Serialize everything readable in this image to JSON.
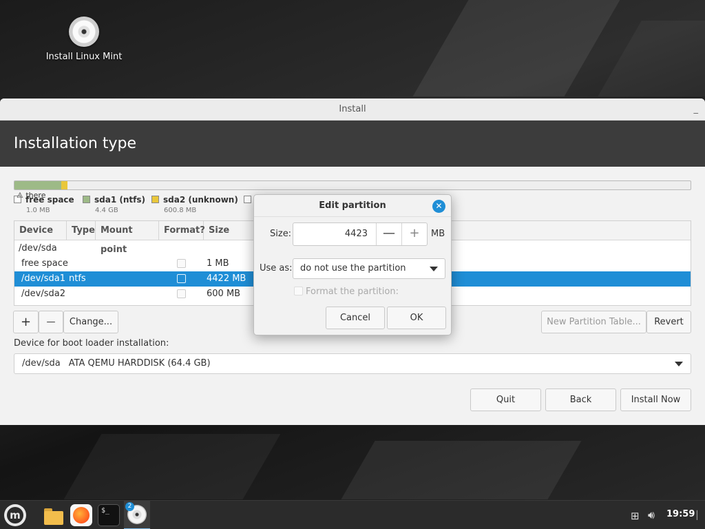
{
  "desktop": {
    "icon_label": "Install Linux Mint"
  },
  "window": {
    "title": "Install"
  },
  "header": {
    "title": "Installation type"
  },
  "legend": {
    "warning_text": "there",
    "items": [
      {
        "label": "free space",
        "size": "1.0 MB",
        "color": "#ffffff"
      },
      {
        "label": "sda1 (ntfs)",
        "size": "4.4 GB",
        "color": "#9dba87"
      },
      {
        "label": "sda2 (unknown)",
        "size": "600.8 MB",
        "color": "#e9c73b"
      },
      {
        "label": "",
        "size": "",
        "color": "#ffffff"
      }
    ]
  },
  "table": {
    "columns": [
      "Device",
      "Type",
      "Mount point",
      "Format?",
      "Size"
    ],
    "rows": [
      {
        "device": "/dev/sda",
        "type": "",
        "mount": "",
        "size": ""
      },
      {
        "device": "free space",
        "type": "",
        "mount": "",
        "size": "1 MB"
      },
      {
        "device": "/dev/sda1",
        "type": "ntfs",
        "mount": "",
        "size": "4422 MB"
      },
      {
        "device": "/dev/sda2",
        "type": "",
        "mount": "",
        "size": "600 MB"
      }
    ]
  },
  "toolbar": {
    "add_label": "+",
    "remove_label": "—",
    "change_label": "Change...",
    "new_table_label": "New Partition Table...",
    "revert_label": "Revert"
  },
  "bootloader": {
    "label": "Device for boot loader installation:",
    "device": "/dev/sda",
    "description": "ATA QEMU HARDDISK (64.4 GB)"
  },
  "footer": {
    "quit_label": "Quit",
    "back_label": "Back",
    "install_label": "Install Now"
  },
  "dialog": {
    "title": "Edit partition",
    "size_label": "Size:",
    "size_value": "4423",
    "size_unit": "MB",
    "minus": "—",
    "plus": "+",
    "use_as_label": "Use as:",
    "use_as_value": "do not use the partition",
    "format_label": "Format the partition:",
    "cancel_label": "Cancel",
    "ok_label": "OK"
  },
  "taskbar": {
    "workspace_badge": "2",
    "terminal_glyph": "$_",
    "clock": "19:59"
  },
  "colors": {
    "accent": "#1f8ed6",
    "header_bg": "#3c3c3c"
  }
}
